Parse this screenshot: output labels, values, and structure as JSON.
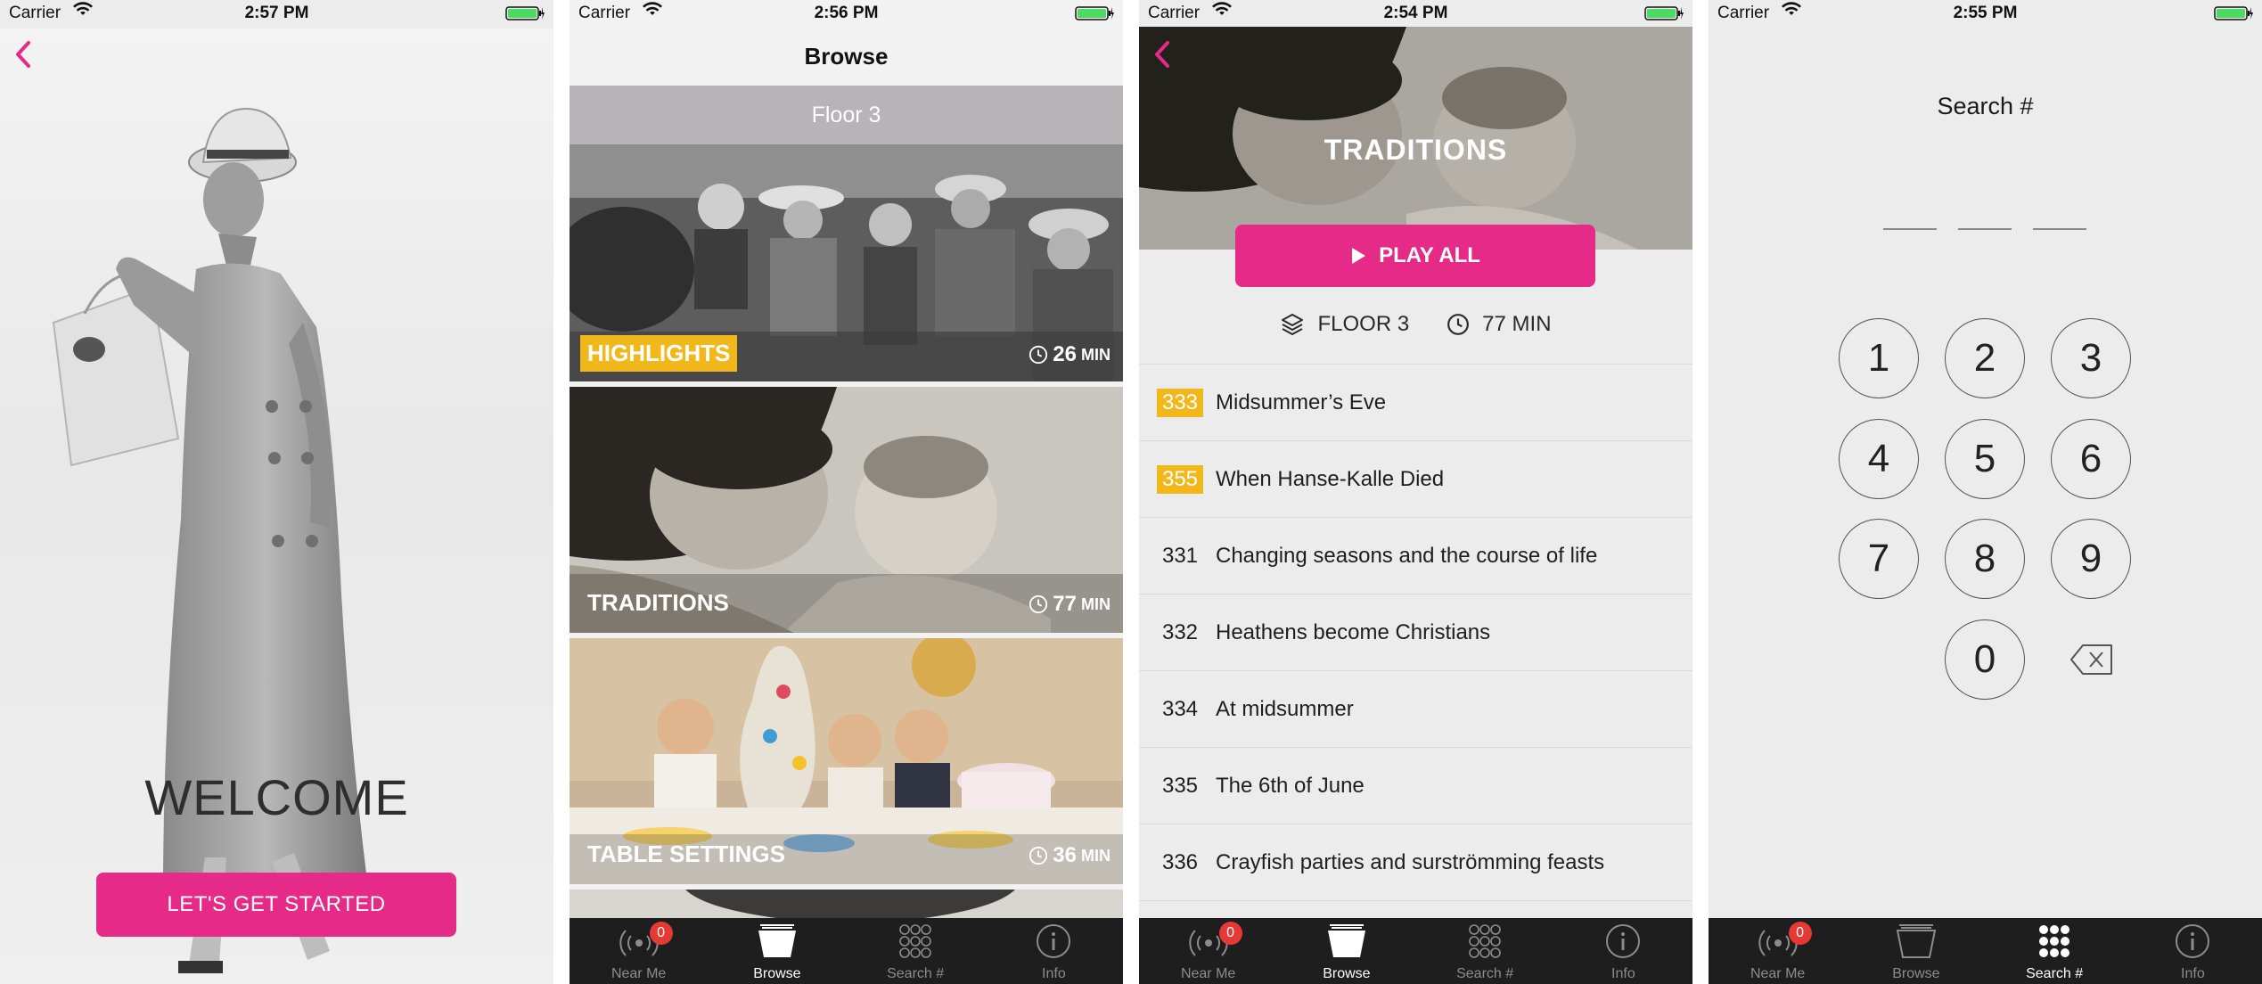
{
  "screens": {
    "welcome": {
      "status": {
        "carrier": "Carrier",
        "time": "2:57 PM"
      },
      "title": "WELCOME",
      "cta_label": "LET'S GET STARTED"
    },
    "browse": {
      "status": {
        "carrier": "Carrier",
        "time": "2:56 PM"
      },
      "nav_title": "Browse",
      "floor_label": "Floor 3",
      "cards": [
        {
          "label": "HIGHLIGHTS",
          "duration": "26",
          "unit": "MIN",
          "tag_style": "yellow"
        },
        {
          "label": "TRADITIONS",
          "duration": "77",
          "unit": "MIN",
          "tag_style": "plain"
        },
        {
          "label": "TABLE SETTINGS",
          "duration": "36",
          "unit": "MIN",
          "tag_style": "plain"
        }
      ]
    },
    "traditions": {
      "status": {
        "carrier": "Carrier",
        "time": "2:54 PM"
      },
      "title": "TRADITIONS",
      "play_label": "PLAY ALL",
      "floor_meta": "FLOOR 3",
      "duration_meta": "77 MIN",
      "items": [
        {
          "number": "333",
          "title": "Midsummer’s Eve",
          "highlight": true
        },
        {
          "number": "355",
          "title": "When Hanse-Kalle Died",
          "highlight": true
        },
        {
          "number": "331",
          "title": "Changing seasons and the course of life",
          "highlight": false
        },
        {
          "number": "332",
          "title": "Heathens become Christians",
          "highlight": false
        },
        {
          "number": "334",
          "title": "At midsummer",
          "highlight": false
        },
        {
          "number": "335",
          "title": "The 6th of June",
          "highlight": false
        },
        {
          "number": "336",
          "title": "Crayfish parties and surströmming feasts",
          "highlight": false
        }
      ]
    },
    "search": {
      "status": {
        "carrier": "Carrier",
        "time": "2:55 PM"
      },
      "title": "Search #",
      "keys": [
        "1",
        "2",
        "3",
        "4",
        "5",
        "6",
        "7",
        "8",
        "9",
        "0"
      ]
    }
  },
  "tabbar": {
    "tabs": [
      {
        "label": "Near Me",
        "icon": "near-me-icon"
      },
      {
        "label": "Browse",
        "icon": "browse-icon"
      },
      {
        "label": "Search #",
        "icon": "search-grid-icon"
      },
      {
        "label": "Info",
        "icon": "info-icon"
      }
    ],
    "near_me_badge": "0"
  },
  "colors": {
    "accent_pink": "#e52b87",
    "highlight_yellow": "#f2b81b",
    "tabbar_bg": "#1e1e1e",
    "badge_red": "#e53935"
  }
}
